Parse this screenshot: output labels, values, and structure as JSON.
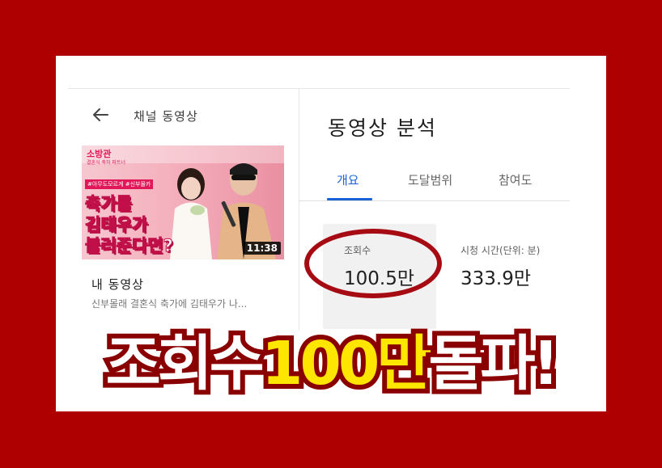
{
  "sidebar": {
    "back_icon": "arrow-left-icon",
    "channel_title": "채널 동영상",
    "thumbnail": {
      "brand": "소방관",
      "brand_sub": "결혼식 축하 파트너",
      "hashtag": "#아무도모르게 #신부몰카",
      "line1": "축가를",
      "line2": "김태우가",
      "line3": "불러준다면?",
      "duration": "11:38"
    },
    "my_videos_label": "내 동영상",
    "video_title": "신부몰래 결혼식 축가에 김태우가 나..."
  },
  "analytics": {
    "title": "동영상 분석",
    "tabs": [
      {
        "label": "개요",
        "active": true
      },
      {
        "label": "도달범위",
        "active": false
      },
      {
        "label": "참여도",
        "active": false
      }
    ],
    "metrics": [
      {
        "label": "조회수",
        "value": "100.5만"
      },
      {
        "label": "시청 시간(단위: 분)",
        "value": "333.9만"
      }
    ]
  },
  "banner": {
    "part1": "조회수",
    "part2": "100만",
    "part3": "돌파!"
  },
  "colors": {
    "frame": "#ae0000",
    "accent_tab": "#1a63d6",
    "highlight_circle": "#a60a12",
    "banner_yellow": "#ffe600"
  }
}
